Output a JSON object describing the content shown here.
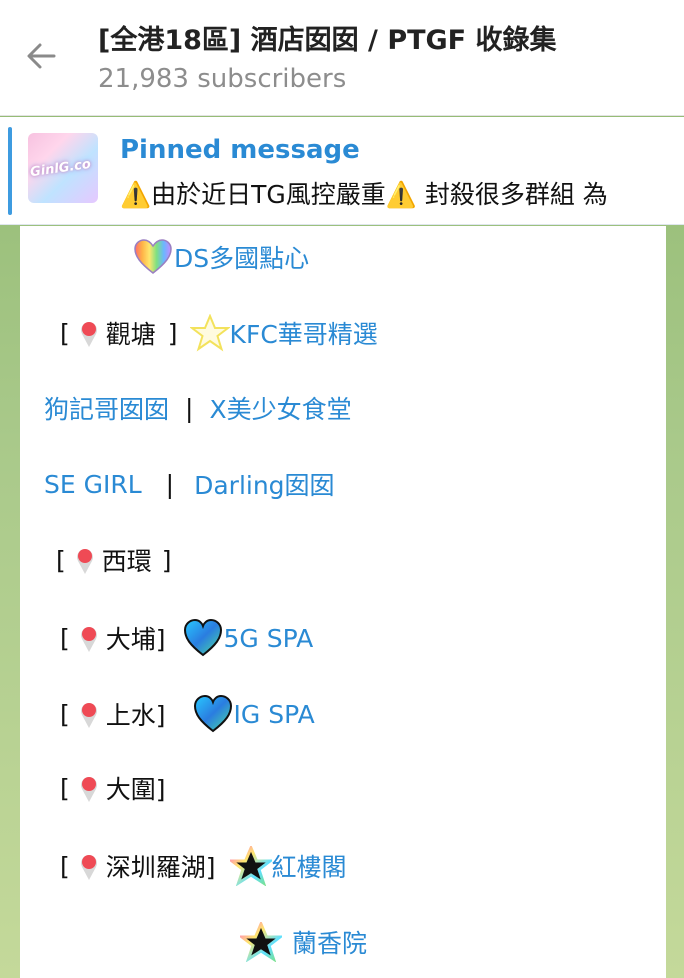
{
  "header": {
    "title": "[全港18區] 酒店囡囡 / PTGF 收錄集",
    "subscribers": "21,983 subscribers"
  },
  "pinned": {
    "label": "Pinned message",
    "thumb_text": "GinlG.co",
    "text": "⚠️由於近日TG風控嚴重⚠️ 封殺很多群組 為"
  },
  "message": {
    "ds_link": "DS多國點心",
    "line_kwuntong": {
      "bracket_open": "[",
      "district": "觀塘",
      "bracket_close": "]",
      "link": "KFC華哥精選"
    },
    "line_dogs": {
      "link1": "狗記哥囡囡",
      "sep": "|",
      "link2": "X美少女食堂"
    },
    "line_segirl": {
      "link1": "SE GIRL",
      "sep": "|",
      "link2": "Darling囡囡"
    },
    "line_saiwan": {
      "bracket_open": "[",
      "district": "西環",
      "bracket_close": "]"
    },
    "line_taipo": {
      "bracket_open": "[",
      "district": "大埔]",
      "link": "5G SPA"
    },
    "line_sheungshui": {
      "bracket_open": "[",
      "district": "上水]",
      "link": "IG SPA"
    },
    "line_taiwai": {
      "bracket_open": "[",
      "district": "大圍]"
    },
    "line_shenzhen": {
      "bracket_open": "[",
      "district": "深圳羅湖]",
      "link": "紅樓閣"
    },
    "line_lanxiang": {
      "link": "蘭香院"
    }
  },
  "colors": {
    "accent": "#2a8ad4",
    "pin": "#ef4a55",
    "chat_bg": "#a9c98a"
  },
  "icons": [
    "back-arrow-icon",
    "location-pin-icon",
    "rainbow-heart-icon",
    "glowing-star-icon",
    "blue-heart-icon",
    "black-star-icon"
  ]
}
